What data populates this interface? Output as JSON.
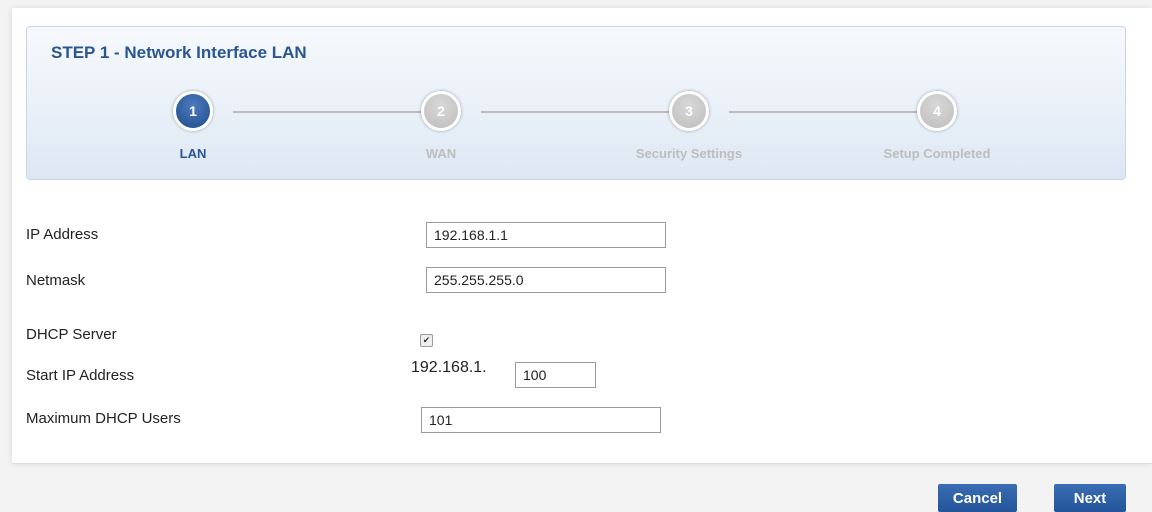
{
  "wizard": {
    "title": "STEP 1 - Network Interface LAN",
    "steps": [
      {
        "number": "1",
        "label": "LAN",
        "active": true
      },
      {
        "number": "2",
        "label": "WAN",
        "active": false
      },
      {
        "number": "3",
        "label": "Security Settings",
        "active": false
      },
      {
        "number": "4",
        "label": "Setup Completed",
        "active": false
      }
    ]
  },
  "form": {
    "ip_address": {
      "label": "IP Address",
      "value": "192.168.1.1"
    },
    "netmask": {
      "label": "Netmask",
      "value": "255.255.255.0"
    },
    "dhcp_server": {
      "label": "DHCP Server",
      "checked": true
    },
    "start_ip": {
      "label": "Start IP Address",
      "prefix": "192.168.1.",
      "value": "100"
    },
    "max_dhcp_users": {
      "label": "Maximum DHCP Users",
      "value": "101"
    }
  },
  "buttons": {
    "cancel": "Cancel",
    "next": "Next"
  },
  "colors": {
    "accent": "#2a5593",
    "button": "#2d5fa6",
    "inactive_step": "#bdbdbd"
  }
}
